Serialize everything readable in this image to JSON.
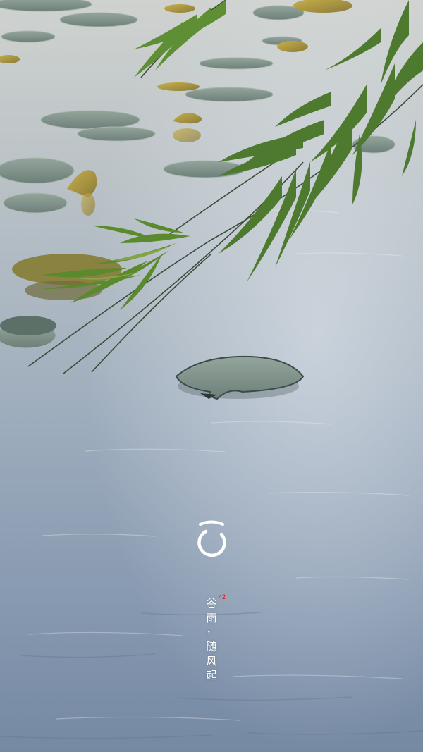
{
  "poem": {
    "chars": [
      "谷",
      "雨",
      "，",
      "随",
      "风",
      "起"
    ]
  },
  "tag": {
    "number": "42",
    "color": "#e0161a"
  },
  "logo": {
    "icon": "ring-logo-icon",
    "color": "#ffffff"
  },
  "colors": {
    "water_top": "#c9cdcd",
    "water_bottom": "#7f94ae",
    "lily_pad": "#7f938c",
    "willow": "#3f6a2a"
  }
}
